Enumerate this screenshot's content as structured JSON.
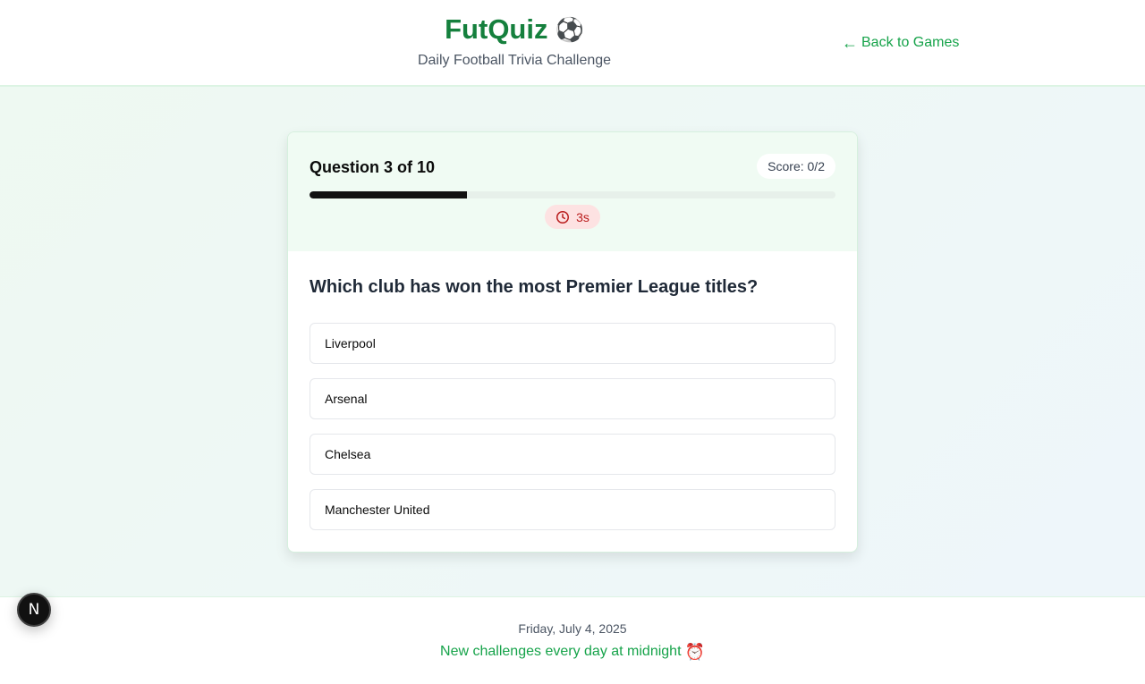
{
  "header": {
    "title": "FutQuiz",
    "title_icon": "⚽",
    "subtitle": "Daily Football Trivia Challenge",
    "back_link_arrow": "←",
    "back_link": "Back to Games"
  },
  "quiz": {
    "question_counter": "Question 3 of 10",
    "score": "Score: 0/2",
    "progress_fraction": 0.3,
    "timer": "3s",
    "question": "Which club has won the most Premier League titles?",
    "options": [
      "Liverpool",
      "Arsenal",
      "Chelsea",
      "Manchester United"
    ]
  },
  "footer": {
    "date": "Friday, July 4, 2025",
    "note": "New challenges every day at midnight",
    "note_icon": "⏰"
  },
  "dev_button": {
    "label": "N"
  },
  "colors": {
    "brand_green": "#15803d",
    "link_green": "#16a34a",
    "progress_fill": "#111111",
    "timer_bg": "#fde2e2",
    "timer_text": "#b91c1c"
  }
}
